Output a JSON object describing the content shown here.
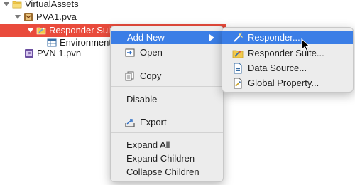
{
  "tree": {
    "root_label": "VirtualAssets",
    "pva_label": "PVA1.pva",
    "suite_label": "Responder Suite",
    "env_label": "Environments",
    "pvn_label": "PVN 1.pvn"
  },
  "context_menu": {
    "add_new": "Add New",
    "open": "Open",
    "copy": "Copy",
    "disable": "Disable",
    "export": "Export",
    "expand_all": "Expand All",
    "expand_children": "Expand Children",
    "collapse_children": "Collapse Children"
  },
  "submenu": {
    "responder": "Responder...",
    "responder_suite": "Responder Suite...",
    "data_source": "Data Source...",
    "global_property": "Global Property..."
  },
  "colors": {
    "tree_selection": "#e94b3c",
    "menu_highlight": "#3b7ee6",
    "menu_background": "#ececec"
  },
  "icons": {
    "root": "folder-icon",
    "pva": "project-icon",
    "suite": "suite-folder-icon",
    "env": "table-icon",
    "pvn": "network-file-icon",
    "open": "open-icon",
    "copy": "copy-icon",
    "export": "export-icon",
    "responder": "wand-icon",
    "responder_suite": "suite-icon",
    "data_source": "data-source-icon",
    "global_property": "property-icon"
  }
}
